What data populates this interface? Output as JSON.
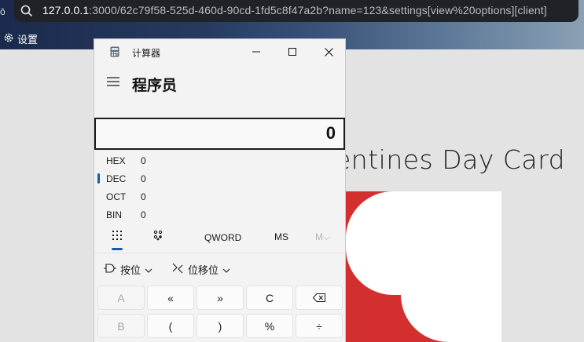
{
  "browser": {
    "url_host": "127.0.0.1",
    "url_rest": ":3000/62c79f58-525d-460d-90cd-1fd5c8f47a2b?name=123&settings[view%20options][client]",
    "settings_label": "设置"
  },
  "page": {
    "title": "entines Day Card",
    "colors": {
      "heart_red": "#d32f2f",
      "heart_white": "#ffffff"
    }
  },
  "calculator": {
    "window_title": "计算器",
    "mode": "程序员",
    "display_value": "0",
    "radix": [
      {
        "label": "HEX",
        "value": "0",
        "selected": false
      },
      {
        "label": "DEC",
        "value": "0",
        "selected": true
      },
      {
        "label": "OCT",
        "value": "0",
        "selected": false
      },
      {
        "label": "BIN",
        "value": "0",
        "selected": false
      }
    ],
    "word_size": "QWORD",
    "ms_label": "MS",
    "m_dropdown_label": "M",
    "bitwise_label": "按位",
    "bitshift_label": "位移位",
    "keys_row1": [
      "A",
      "«",
      "»",
      "C",
      "⌫"
    ],
    "keys_row2": [
      "B",
      "(",
      ")",
      "%",
      "÷"
    ],
    "accent_color": "#0f5ea8"
  }
}
